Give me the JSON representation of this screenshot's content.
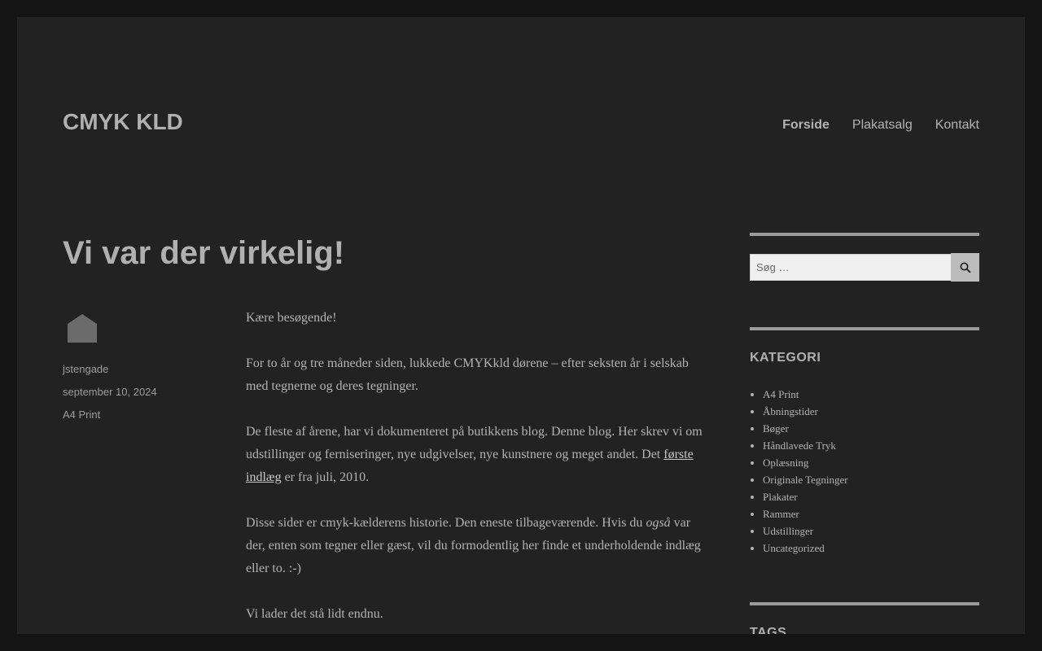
{
  "header": {
    "site_title": "CMYK KLD",
    "nav": [
      "Forside",
      "Plakatsalg",
      "Kontakt"
    ]
  },
  "post": {
    "title": "Vi var der virkelig!",
    "author": "jstengade",
    "date": "september 10, 2024",
    "category": "A4 Print",
    "p1": "Kære besøgende!",
    "p2": "For to år og tre måneder siden, lukkede CMYKkld dørene – efter seksten år i selskab med tegnerne og deres tegninger.",
    "p3_before": "De fleste af årene, har vi dokumenteret på butikkens blog. Denne blog. Her skrev vi om udstillinger og ferniseringer, nye udgivelser, nye kunstnere og meget andet. Det ",
    "p3_link": "første indlæg",
    "p3_after": " er fra juli, 2010.",
    "p4_before": "Disse sider er cmyk-kælderens historie. Den eneste tilbageværende. Hvis du ",
    "p4_em": "også",
    "p4_after": " var der, enten som tegner eller gæst, vil du formodentlig her finde et underholdende indlæg eller to. :-)",
    "p5": "Vi lader det stå lidt endnu."
  },
  "sidebar": {
    "search_placeholder": "Søg …",
    "kategori_title": "KATEGORI",
    "categories": [
      "A4 Print",
      "Åbningstider",
      "Bøger",
      "Håndlavede Tryk",
      "Oplæsning",
      "Originale Tegninger",
      "Plakater",
      "Rammer",
      "Udstillinger",
      "Uncategorized"
    ],
    "tags_title": "TAGS"
  },
  "colors": {
    "page_bg": "#141414",
    "content_bg": "#222222",
    "text": "#b3b3b3",
    "search_button": "#bcbcbc"
  },
  "icons": {
    "search": "magnifier-icon",
    "avatar": "avatar-placeholder-icon"
  }
}
